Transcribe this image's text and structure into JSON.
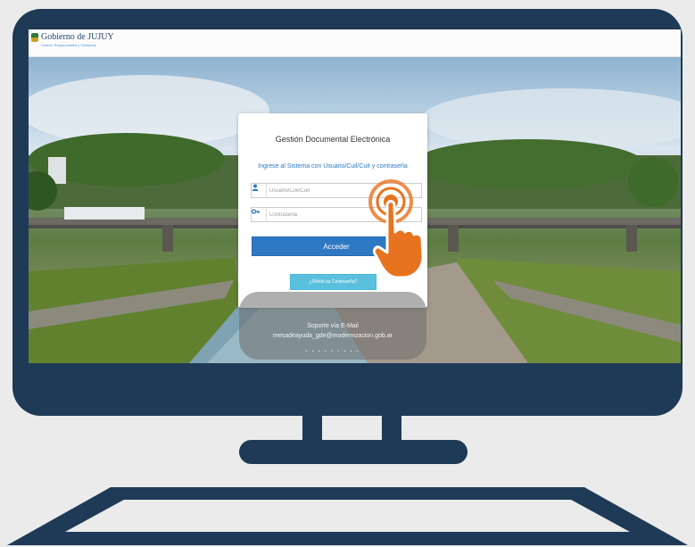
{
  "header": {
    "brand": "Gobierno de JUJUY",
    "tagline": "Unidos, Responsables y Solidarios"
  },
  "login": {
    "title": "Gestión Documental Electrónica",
    "subtitle": "Ingrese al Sistema con Usuario/Cuil/Cuit y contraseña",
    "username_placeholder": "Usuario/Cuil/Cuit",
    "password_placeholder": "Contraseña",
    "submit_label": "Acceder",
    "forgot_label": "¿Olvidó su Contraseña?",
    "user_icon": "user-icon",
    "key_icon": "key-icon"
  },
  "support": {
    "title": "Soporte vía E-Mail",
    "email": "mesadeayuda_gde@modernizacion.gob.ar",
    "carousel_dots": "• • • • • • • • •"
  },
  "colors": {
    "frame": "#1f3a56",
    "primary": "#2f78c4",
    "info": "#5bc0de",
    "accent": "#e8731f"
  }
}
